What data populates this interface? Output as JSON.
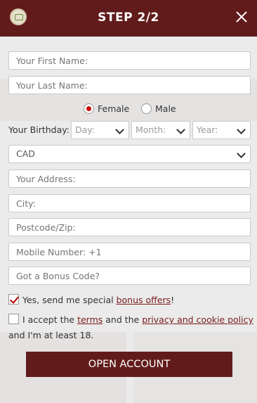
{
  "header": {
    "title": "STEP 2/2",
    "logo_icon": "chat-icon",
    "close_icon": "close-icon"
  },
  "form": {
    "first_name_placeholder": "Your First Name:",
    "last_name_placeholder": "Your Last Name:",
    "gender": {
      "female_label": "Female",
      "male_label": "Male",
      "selected": "Female"
    },
    "birthday": {
      "label": "Your Birthday:",
      "day_placeholder": "Day:",
      "month_placeholder": "Month:",
      "year_placeholder": "Year:"
    },
    "currency_value": "CAD",
    "address_placeholder": "Your Address:",
    "city_placeholder": "City:",
    "postcode_placeholder": "Postcode/Zip:",
    "mobile_placeholder": "Mobile Number: +1",
    "bonus_code_placeholder": "Got a Bonus Code?",
    "offers": {
      "prefix": "Yes, send me special ",
      "link": "bonus offers",
      "suffix": "!",
      "checked": true
    },
    "terms": {
      "prefix": "I accept the ",
      "terms_link": "terms",
      "middle": " and the ",
      "privacy_link": "privacy and cookie policy",
      "line2": "and I'm at least 18.",
      "checked": false
    },
    "submit_label": "OPEN ACCOUNT"
  },
  "colors": {
    "brand": "#621b1b",
    "accent": "#cc0000"
  }
}
